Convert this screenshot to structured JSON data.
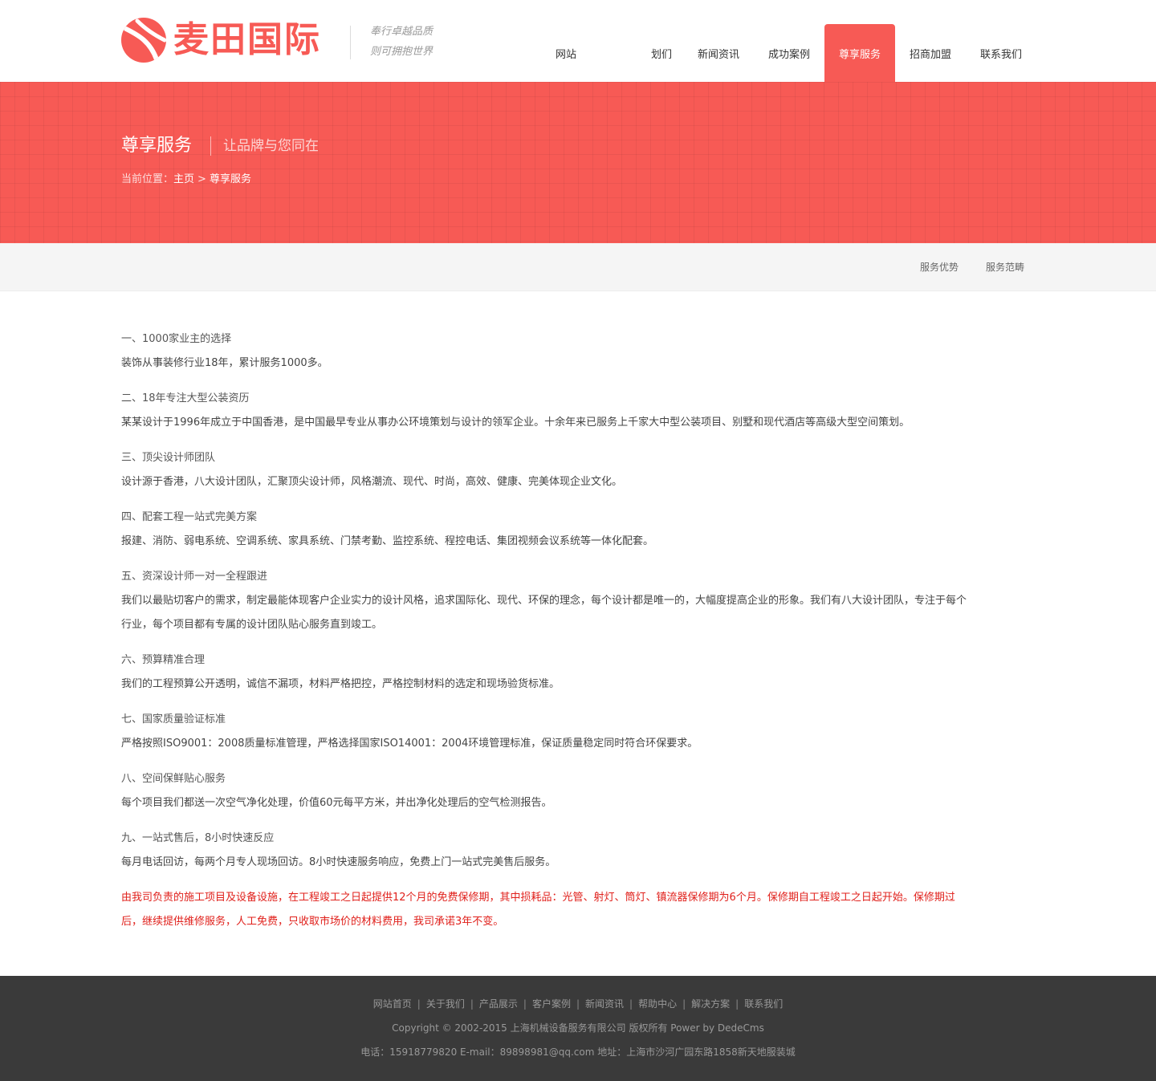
{
  "brand": {
    "name": "麦田国际",
    "slogan_line1": "奉行卓越品质",
    "slogan_line2": "则可拥抱世界",
    "color": "#f75a55"
  },
  "nav": {
    "items": [
      {
        "label": "网站"
      },
      {
        "label": "划们"
      },
      {
        "label": "新闻资讯"
      },
      {
        "label": "成功案例"
      },
      {
        "label": "尊享服务",
        "active": true
      },
      {
        "label": "招商加盟"
      },
      {
        "label": "联系我们"
      }
    ]
  },
  "banner": {
    "title": "尊享服务",
    "subtitle": "让品牌与您同在",
    "breadcrumb_prefix": "当前位置：",
    "breadcrumb_home": "主页",
    "breadcrumb_sep": ">",
    "breadcrumb_current": "尊享服务"
  },
  "subnav": {
    "items": [
      {
        "label": "服务优势"
      },
      {
        "label": "服务范畴"
      }
    ]
  },
  "content": {
    "sections": [
      {
        "heading": " 一、1000家业主的选择",
        "body": "装饰从事装修行业18年，累计服务1000多。"
      },
      {
        "heading": "二、18年专注大型公装资历",
        "body": "某某设计于1996年成立于中国香港，是中国最早专业从事办公环境策划与设计的领军企业。十余年来已服务上千家大中型公装项目、别墅和现代酒店等高级大型空间策划。"
      },
      {
        "heading": "三、顶尖设计师团队",
        "body": "设计源于香港，八大设计团队，汇聚顶尖设计师，风格潮流、现代、时尚，高效、健康、完美体现企业文化。"
      },
      {
        "heading": "四、配套工程一站式完美方案",
        "body": "报建、消防、弱电系统、空调系统、家具系统、门禁考勤、监控系统、程控电话、集团视频会议系统等一体化配套。"
      },
      {
        "heading": "五、资深设计师一对一全程跟进",
        "body_line1": "我们以最贴切客户的需求，制定最能体现客户企业实力的设计风格，追求国际化、现代、环保的理念，每个设计都是唯一的，大幅度提高企业的形象。我们有八大设计团队，专注于每个",
        "body_line2": "行业，每个项目都有专属的设计团队贴心服务直到竣工。"
      },
      {
        "heading": "六、预算精准合理",
        "body": "我们的工程预算公开透明，诚信不漏项，材料严格把控，严格控制材料的选定和现场验货标准。"
      },
      {
        "heading": "七、国家质量验证标准",
        "body": "严格按照ISO9001：2008质量标准管理，严格选择国家ISO14001：2004环境管理标准，保证质量稳定同时符合环保要求。"
      },
      {
        "heading": "八、空间保鲜贴心服务",
        "body": "每个项目我们都送一次空气净化处理，价值60元每平方米，并出净化处理后的空气检测报告。"
      },
      {
        "heading": "九、一站式售后，8小时快速反应",
        "body": "每月电话回访，每两个月专人现场回访。8小时快速服务响应，免费上门一站式完美售后服务。"
      }
    ],
    "notice_line1": "由我司负责的施工项目及设备设施，在工程竣工之日起提供12个月的免费保修期，其中损耗品：光管、射灯、筒灯、镇流器保修期为6个月。保修期自工程竣工之日起开始。保修期过",
    "notice_line2": "后，继续提供维修服务，人工免费，只收取市场价的材料费用，我司承诺3年不变。",
    "notice_color": "#e0201b"
  },
  "footer": {
    "links": [
      "网站首页",
      "关于我们",
      "产品展示",
      "客户案例",
      "新闻资讯",
      "帮助中心",
      "解决方案",
      "联系我们"
    ],
    "separator": "|",
    "copyright": "Copyright © 2002-2015 上海机械设备服务有限公司 版权所有 Power by DedeCms",
    "contact": "电话：15918779820 E-mail：89898981@qq.com 地址：上海市沙河广园东路1858新天地服装城"
  }
}
